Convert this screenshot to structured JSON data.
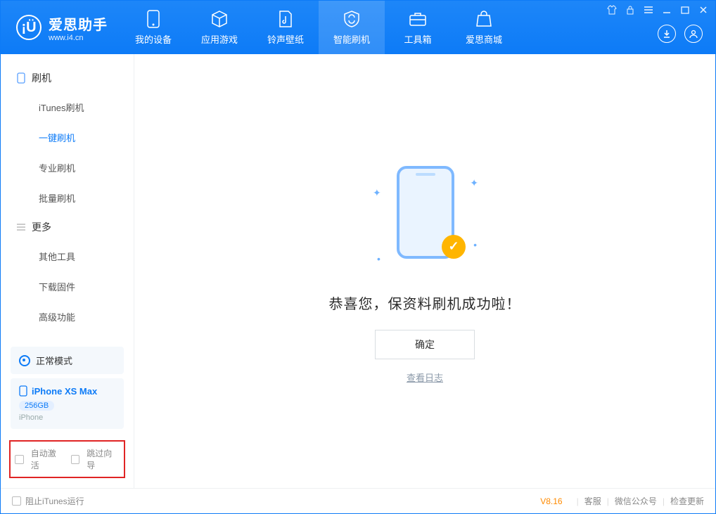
{
  "app": {
    "name_cn": "爱思助手",
    "name_en": "www.i4.cn"
  },
  "nav": {
    "items": [
      {
        "label": "我的设备"
      },
      {
        "label": "应用游戏"
      },
      {
        "label": "铃声壁纸"
      },
      {
        "label": "智能刷机"
      },
      {
        "label": "工具箱"
      },
      {
        "label": "爱思商城"
      }
    ],
    "active_index": 3
  },
  "sidebar": {
    "groups": [
      {
        "title": "刷机",
        "icon": "phone-icon",
        "items": [
          {
            "label": "iTunes刷机"
          },
          {
            "label": "一键刷机",
            "active": true
          },
          {
            "label": "专业刷机"
          },
          {
            "label": "批量刷机"
          }
        ]
      },
      {
        "title": "更多",
        "icon": "list-icon",
        "items": [
          {
            "label": "其他工具"
          },
          {
            "label": "下载固件"
          },
          {
            "label": "高级功能"
          }
        ]
      }
    ],
    "mode_label": "正常模式",
    "device": {
      "name": "iPhone XS Max",
      "capacity": "256GB",
      "type": "iPhone"
    },
    "bottom_checks": [
      {
        "label": "自动激活"
      },
      {
        "label": "跳过向导"
      }
    ]
  },
  "main": {
    "message": "恭喜您，保资料刷机成功啦！",
    "ok_label": "确定",
    "log_link": "查看日志"
  },
  "footer": {
    "block_itunes": "阻止iTunes运行",
    "version": "V8.16",
    "links": [
      "客服",
      "微信公众号",
      "检查更新"
    ]
  }
}
